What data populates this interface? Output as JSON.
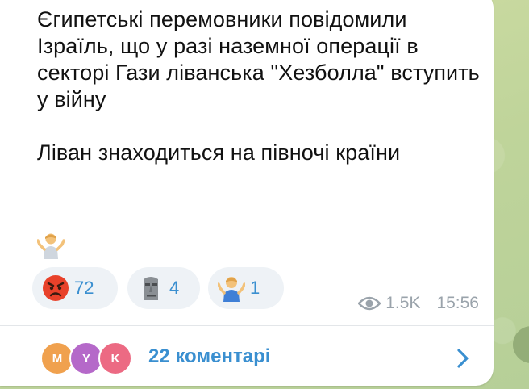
{
  "message": {
    "paragraph1": "Єгипетські перемовники повідомили Ізраїль, що у разі наземної операції в секторі Гази ліванська \"Хезболла\" вступить у війну",
    "paragraph2": "Ліван знаходиться на півночі країни",
    "trailing_emoji": "person-shrugging-emoji"
  },
  "reactions": [
    {
      "emoji": "angry-face-emoji",
      "count": "72"
    },
    {
      "emoji": "moai-emoji",
      "count": "4"
    },
    {
      "emoji": "person-shrugging-emoji",
      "count": "1"
    }
  ],
  "meta": {
    "views": "1.5K",
    "time": "15:56",
    "icon": "eye-icon"
  },
  "comments": {
    "avatars": [
      {
        "letter": "M",
        "color": "#f0a14e"
      },
      {
        "letter": "Y",
        "color": "#b569c9"
      },
      {
        "letter": "K",
        "color": "#ec6a83"
      }
    ],
    "label": "22 коментарі",
    "icon": "chevron-right-icon"
  },
  "colors": {
    "accent": "#3a8fd0",
    "bubble": "#ffffff",
    "background": "#c9d9a3"
  }
}
